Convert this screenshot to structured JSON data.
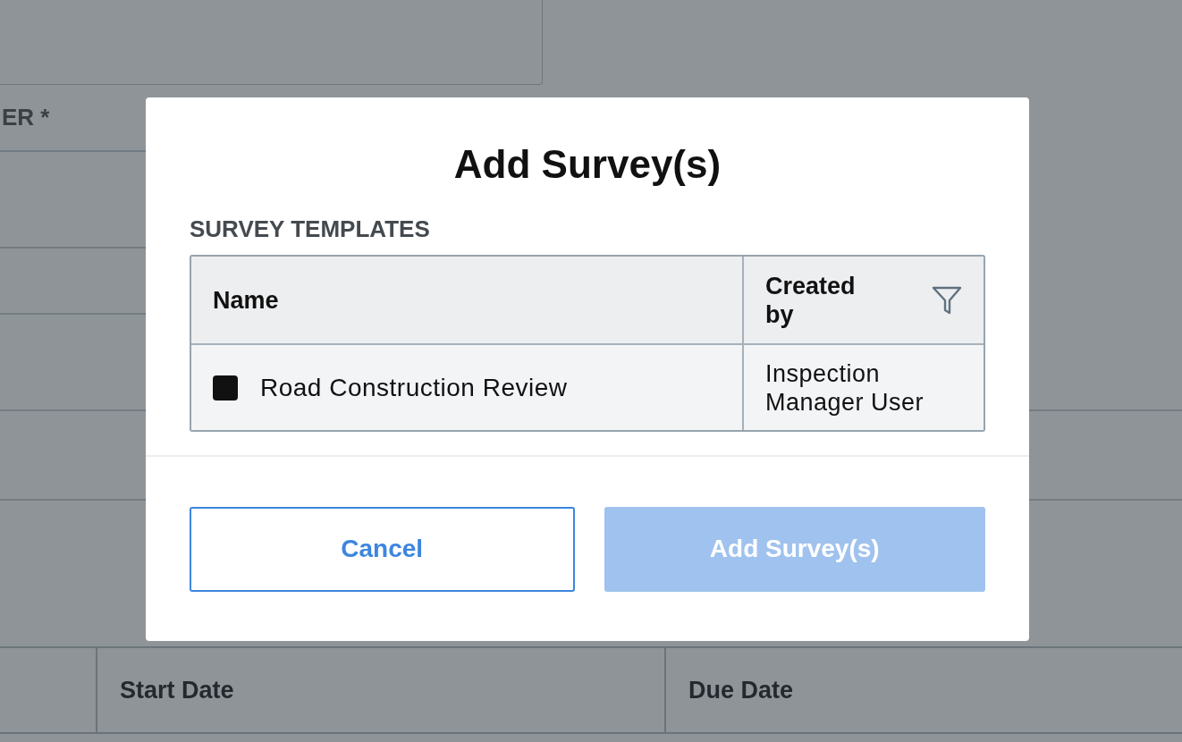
{
  "background": {
    "field_label": "ER *",
    "table_columns": [
      {
        "label": "Start Date"
      },
      {
        "label": "Due Date"
      }
    ]
  },
  "modal": {
    "title": "Add Survey(s)",
    "section_label": "SURVEY TEMPLATES",
    "table": {
      "columns": [
        {
          "label": "Name",
          "filter": false
        },
        {
          "label": "Created by",
          "filter": true
        }
      ],
      "rows": [
        {
          "checked": false,
          "name": "Road Construction Review",
          "created_by": "Inspection Manager User"
        }
      ]
    },
    "buttons": [
      {
        "label": "Cancel",
        "kind": "secondary",
        "disabled": false
      },
      {
        "label": "Add Survey(s)",
        "kind": "primary",
        "disabled": true
      }
    ]
  }
}
